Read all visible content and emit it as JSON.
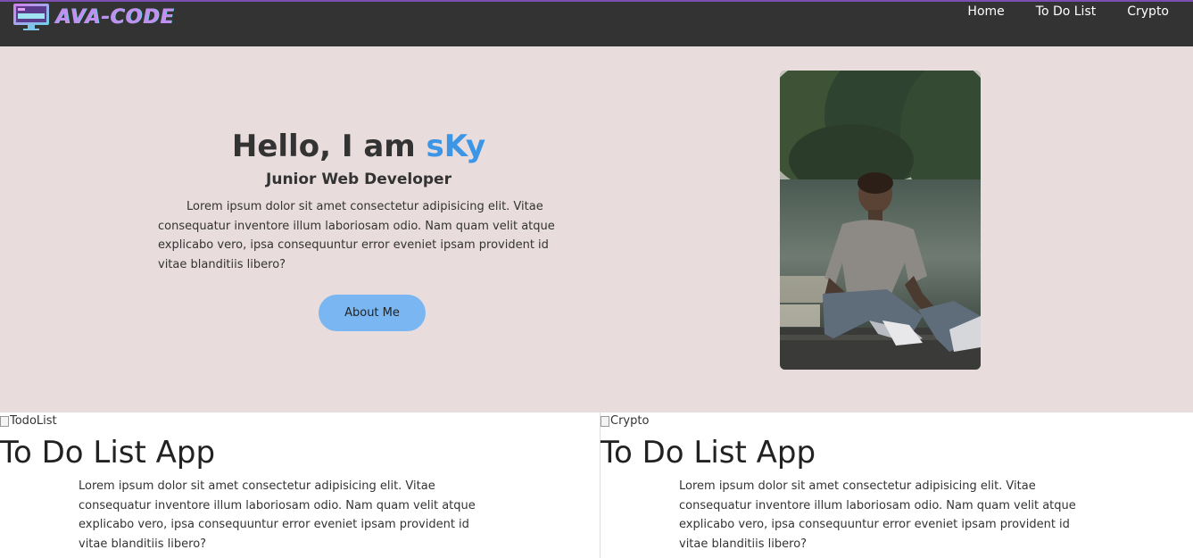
{
  "nav": {
    "logo_text": "AVA-CODE",
    "links": [
      "Home",
      "To Do List",
      "Crypto"
    ]
  },
  "hero": {
    "greeting": "Hello, I am ",
    "name": "sKy",
    "subtitle": "Junior Web Developer",
    "text": "Lorem ipsum dolor sit amet consectetur adipisicing elit. Vitae consequatur inventore illum laboriosam odio. Nam quam velit atque explicabo vero, ipsa consequuntur error eveniet ipsam provident id vitae blanditiis libero?",
    "button_label": "About Me"
  },
  "projects": [
    {
      "img_alt": "TodoList",
      "title": "To Do List App",
      "text": "Lorem ipsum dolor sit amet consectetur adipisicing elit. Vitae consequatur inventore illum laboriosam odio. Nam quam velit atque explicabo vero, ipsa consequuntur error eveniet ipsam provident id vitae blanditiis libero?"
    },
    {
      "img_alt": "Crypto",
      "title": "To Do List App",
      "text": "Lorem ipsum dolor sit amet consectetur adipisicing elit. Vitae consequatur inventore illum laboriosam odio. Nam quam velit atque explicabo vero, ipsa consequuntur error eveniet ipsam provident id vitae blanditiis libero?"
    }
  ],
  "colors": {
    "navbar": "#333333",
    "hero_bg": "#e8dcdc",
    "accent_name": "#3d95e6",
    "button_bg": "#7ab7f2"
  }
}
